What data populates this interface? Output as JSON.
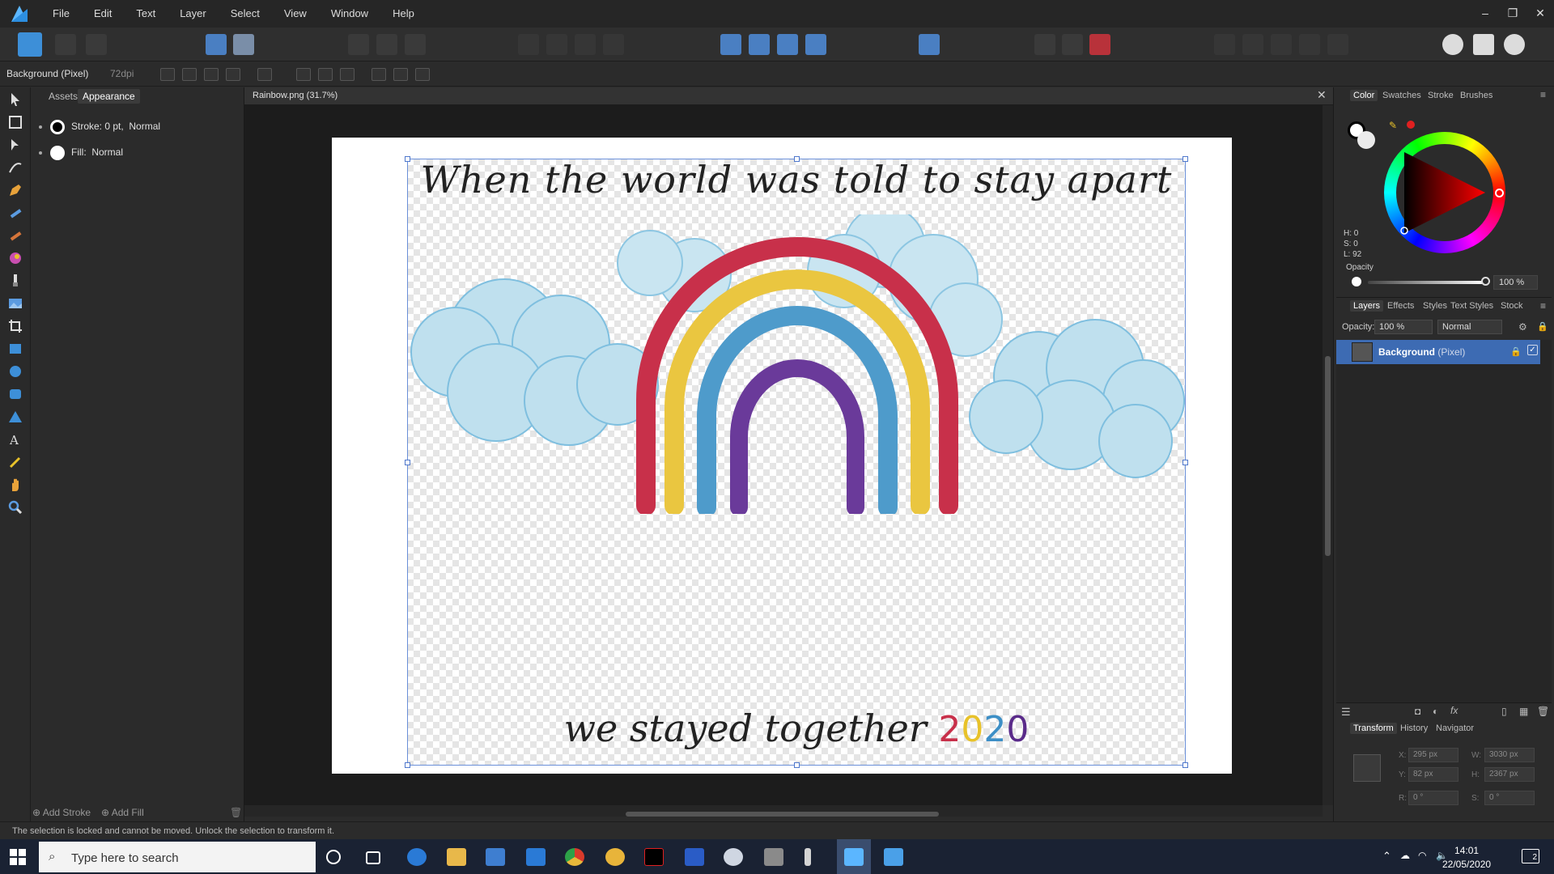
{
  "menu": [
    "File",
    "Edit",
    "Text",
    "Layer",
    "Select",
    "View",
    "Window",
    "Help"
  ],
  "window_controls": [
    "–",
    "❐",
    "✕"
  ],
  "context_bar": {
    "layer": "Background (Pixel)",
    "dpi": "72dpi"
  },
  "left_panel": {
    "tabs": [
      "Assets",
      "Appearance"
    ],
    "stroke": "Stroke: 0 pt,",
    "stroke_mode": "Normal",
    "fill": "Fill:",
    "fill_mode": "Normal",
    "add_stroke": "Add Stroke",
    "add_fill": "Add Fill"
  },
  "document": {
    "tab_title": "Rainbow.png (31.7%)",
    "headline": "When the world was told to stay apart",
    "footline": "we stayed together ",
    "year_digits": [
      "2",
      "0",
      "2",
      "0"
    ],
    "year_colors": [
      "#c8304a",
      "#e8c22a",
      "#3d8fc6",
      "#5a2b8a"
    ]
  },
  "color_panel": {
    "tabs": [
      "Color",
      "Swatches",
      "Stroke",
      "Brushes"
    ],
    "hsl": [
      "H: 0",
      "S: 0",
      "L: 92"
    ],
    "opacity_label": "Opacity",
    "opacity_value": "100 %"
  },
  "layers_panel": {
    "tabs": [
      "Layers",
      "Effects",
      "Styles",
      "Text Styles",
      "Stock"
    ],
    "opacity_label": "Opacity:",
    "opacity_value": "100 %",
    "blend_mode": "Normal",
    "layer_name": "Background",
    "layer_type": " (Pixel)"
  },
  "transform_panel": {
    "tabs": [
      "Transform",
      "History",
      "Navigator"
    ],
    "x_label": "X:",
    "x": "295 px",
    "y_label": "Y:",
    "y": "82 px",
    "w_label": "W:",
    "w": "3030 px",
    "h_label": "H:",
    "h": "2367 px",
    "r_label": "R:",
    "r": "0 °",
    "s_label": "S:",
    "s": "0 °"
  },
  "status": "The selection is locked and cannot be moved. Unlock the selection to transform it.",
  "taskbar": {
    "search_placeholder": "Type here to search",
    "time": "14:01",
    "date": "22/05/2020",
    "notifications": "2"
  },
  "colors": {
    "accent": "#3d6bb3",
    "selection": "#6a8fd8"
  }
}
